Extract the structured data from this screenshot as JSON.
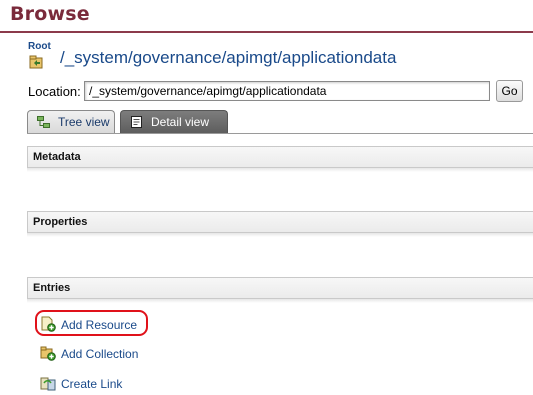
{
  "header": {
    "title": "Browse"
  },
  "breadcrumb": {
    "root_label": "Root",
    "path": "/_system/governance/apimgt/applicationdata"
  },
  "location": {
    "label": "Location:",
    "value": "/_system/governance/apimgt/applicationdata",
    "go_label": "Go"
  },
  "tabs": [
    {
      "label": "Tree view",
      "active": false
    },
    {
      "label": "Detail view",
      "active": true
    }
  ],
  "sections": {
    "metadata": "Metadata",
    "properties": "Properties",
    "entries": "Entries"
  },
  "entries": [
    {
      "label": "Add Resource",
      "icon": "add-resource-icon"
    },
    {
      "label": "Add Collection",
      "icon": "add-collection-icon"
    },
    {
      "label": "Create Link",
      "icon": "create-link-icon"
    }
  ],
  "colors": {
    "title": "#7a2a3b",
    "link": "#1a4a8a",
    "highlight": "#e0111a"
  }
}
